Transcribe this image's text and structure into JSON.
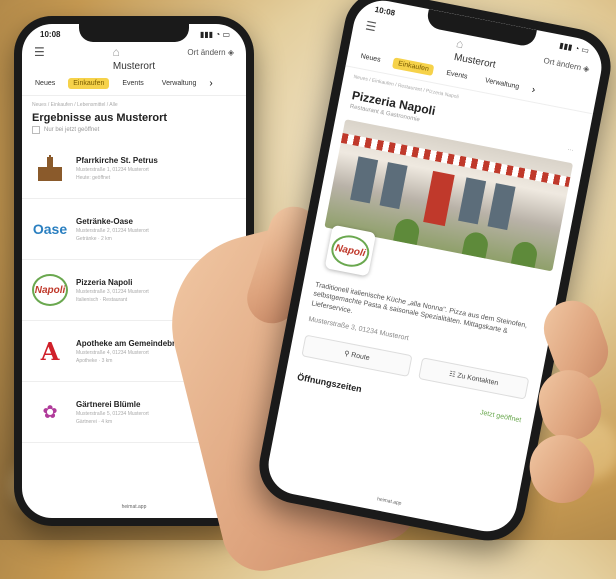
{
  "status": {
    "time": "10:08"
  },
  "left_phone": {
    "town": "Musterort",
    "location_btn": "Ort ändern",
    "tabs": [
      "Neues",
      "Einkaufen",
      "Events",
      "Verwaltung"
    ],
    "active_tab": "Einkaufen",
    "breadcrumb": "Neues / Einkaufen / Lebensmittel / Alle",
    "heading": "Ergebnisse aus Musterort",
    "checkbox_label": "Nur bei jetzt geöffnet",
    "results": [
      {
        "name": "Pfarrkirche St. Petrus",
        "address": "Musterstraße 1, 01234 Musterort",
        "meta": "Heute: geöffnet"
      },
      {
        "name": "Getränke-Oase",
        "address": "Musterstraße 2, 01234 Musterort",
        "meta": "Getränke · 2 km"
      },
      {
        "name": "Pizzeria Napoli",
        "address": "Musterstraße 3, 01234 Musterort",
        "meta": "Italienisch · Restaurant"
      },
      {
        "name": "Apotheke am Gemeindebrunnen",
        "address": "Musterstraße 4, 01234 Musterort",
        "meta": "Apotheke · 3 km"
      },
      {
        "name": "Gärtnerei Blümle",
        "address": "Musterstraße 5, 01234 Musterort",
        "meta": "Gärtnerei · 4 km"
      }
    ],
    "footer": "heimat.app"
  },
  "right_phone": {
    "town": "Musterort",
    "location_btn": "Ort ändern",
    "tabs": [
      "Neues",
      "Einkaufen",
      "Events",
      "Verwaltung"
    ],
    "active_tab": "Einkaufen",
    "breadcrumb": "Neues / Einkaufen / Restaurant / Pizzeria Napoli",
    "title": "Pizzeria Napoli",
    "category": "Restaurant & Gastronomie",
    "logo_text": "Napoli",
    "description": "Traditionell italienische Küche „alla Nonna\". Pizza aus dem Steinofen, selbstgemachte Pasta & saisonale Spezialitäten. Mittagskarte & Lieferservice.",
    "address": "Musterstraße 3, 01234 Musterort",
    "route_btn": "Route",
    "contact_btn": "Zu Kontakten",
    "opening_hours": "Öffnungszeiten",
    "open_status": "Jetzt geöffnet",
    "footer": "heimat.app"
  },
  "colors": {
    "accent": "#f6d24a",
    "open_green": "#6aa84f",
    "napoli_red": "#c0392b"
  }
}
